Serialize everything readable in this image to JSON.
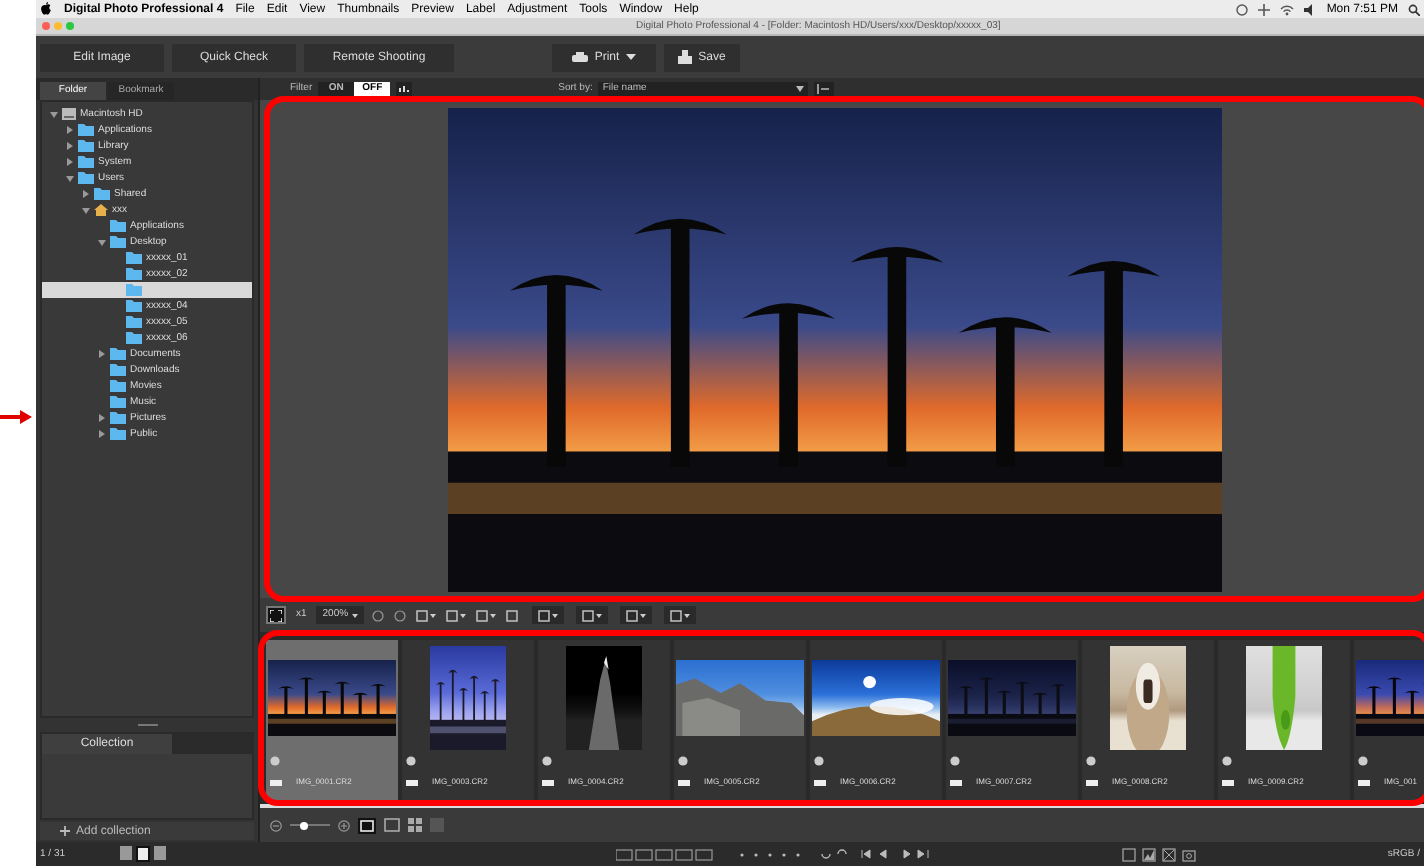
{
  "menu_bar": {
    "app_name": "Digital Photo Professional 4",
    "items": [
      "File",
      "Edit",
      "View",
      "Thumbnails",
      "Preview",
      "Label",
      "Adjustment",
      "Tools",
      "Window",
      "Help"
    ],
    "clock": "Mon 7:51 PM"
  },
  "window": {
    "title": "Digital Photo Professional 4 - [Folder: Macintosh HD/Users/xxx/Desktop/xxxxx_03]"
  },
  "toolbar": {
    "buttons": [
      "Edit Image",
      "Quick Check",
      "Remote Shooting"
    ],
    "print": "Print",
    "save": "Save"
  },
  "sidebar": {
    "tabs": [
      {
        "label": "Folder",
        "selected": true
      },
      {
        "label": "Bookmark",
        "selected": false
      }
    ],
    "tree": [
      {
        "label": "Macintosh HD",
        "kind": "drive",
        "expanded": true,
        "selected": false,
        "children": [
          {
            "label": "Applications",
            "kind": "folder",
            "expanded": false,
            "selected": false
          },
          {
            "label": "Library",
            "kind": "folder",
            "expanded": false,
            "selected": false
          },
          {
            "label": "System",
            "kind": "folder",
            "expanded": false,
            "selected": false
          },
          {
            "label": "Users",
            "kind": "folder",
            "expanded": true,
            "selected": false,
            "children": [
              {
                "label": "Shared",
                "kind": "folder",
                "expanded": false,
                "selected": false
              },
              {
                "label": "xxx",
                "kind": "home",
                "expanded": true,
                "selected": false,
                "children": [
                  {
                    "label": "Applications",
                    "kind": "folder",
                    "selected": false
                  },
                  {
                    "label": "Desktop",
                    "kind": "folder",
                    "expanded": true,
                    "selected": false,
                    "children": [
                      {
                        "label": "xxxxx_01",
                        "kind": "folder",
                        "selected": false
                      },
                      {
                        "label": "xxxxx_02",
                        "kind": "folder",
                        "selected": false
                      },
                      {
                        "kind": "folder",
                        "selected": true
                      },
                      {
                        "label": "xxxxx_04",
                        "kind": "folder",
                        "selected": false
                      },
                      {
                        "label": "xxxxx_05",
                        "kind": "folder",
                        "selected": false
                      },
                      {
                        "label": "xxxxx_06",
                        "kind": "folder",
                        "selected": false
                      }
                    ]
                  },
                  {
                    "label": "Documents",
                    "kind": "folder",
                    "expanded": false,
                    "selected": false
                  },
                  {
                    "label": "Downloads",
                    "kind": "folder",
                    "selected": false
                  },
                  {
                    "label": "Movies",
                    "kind": "folder",
                    "selected": false
                  },
                  {
                    "label": "Music",
                    "kind": "folder",
                    "selected": false
                  },
                  {
                    "label": "Pictures",
                    "kind": "folder",
                    "expanded": false,
                    "selected": false
                  },
                  {
                    "label": "Public",
                    "kind": "folder",
                    "expanded": false,
                    "selected": false
                  }
                ]
              }
            ]
          }
        ]
      }
    ],
    "collection": {
      "tab": "Collection",
      "add": "Add collection"
    }
  },
  "filter": {
    "label": "Filter",
    "options": [
      {
        "label": "ON",
        "selected": false
      },
      {
        "label": "OFF",
        "selected": true
      }
    ],
    "sort_label": "Sort by:",
    "sort_value": "File name"
  },
  "preview": {
    "zoom_mode": "x1",
    "zoom": "200%"
  },
  "thumbnail_size": {
    "level": 0.3
  },
  "thumbnails": [
    {
      "name": "IMG_0001.CR2",
      "selected": true
    },
    {
      "name": "IMG_0003.CR2",
      "selected": false
    },
    {
      "name": "IMG_0004.CR2",
      "selected": false
    },
    {
      "name": "IMG_0005.CR2",
      "selected": false
    },
    {
      "name": "IMG_0006.CR2",
      "selected": false
    },
    {
      "name": "IMG_0007.CR2",
      "selected": false
    },
    {
      "name": "IMG_0008.CR2",
      "selected": false
    },
    {
      "name": "IMG_0009.CR2",
      "selected": false
    },
    {
      "name": "IMG_001",
      "selected": false
    }
  ],
  "status_bar": {
    "count": "1 / 31",
    "color_space": "sRGB /"
  }
}
